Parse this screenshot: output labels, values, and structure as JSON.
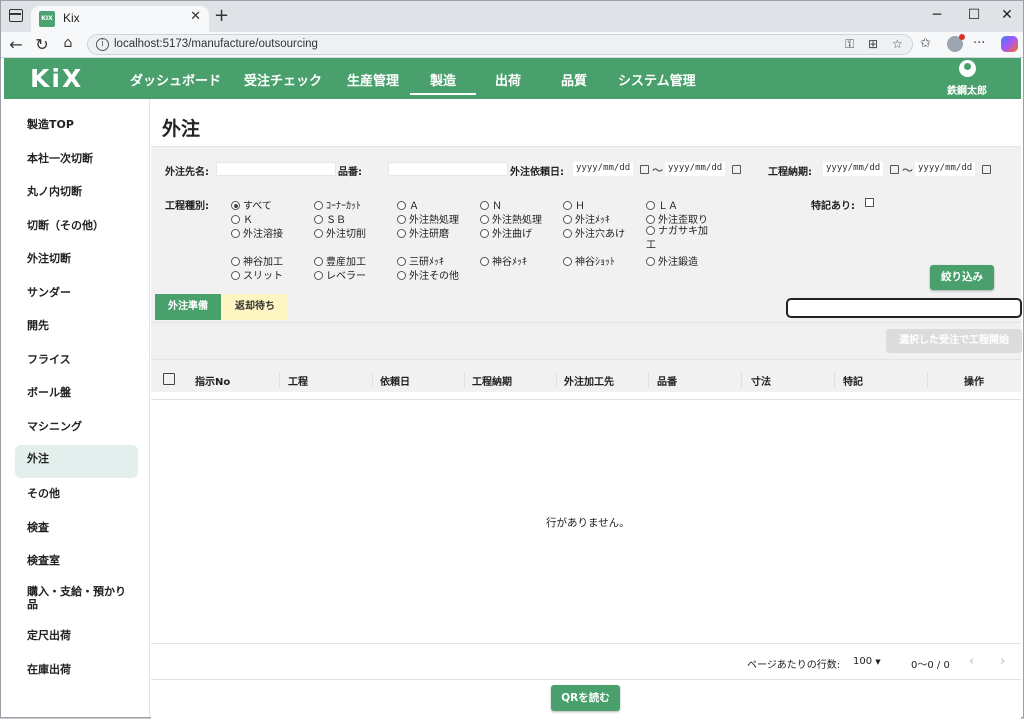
{
  "browser": {
    "tab_title": "Kix",
    "favicon_text": "KIX",
    "url": "localhost:5173/manufacture/outsourcing"
  },
  "header": {
    "logo": "KiX",
    "nav": [
      "ダッシュボード",
      "受注チェック",
      "生産管理",
      "製造",
      "出荷",
      "品質",
      "システム管理"
    ],
    "active_nav": "製造",
    "user_name": "鉄鋼太郎"
  },
  "sidebar": {
    "items": [
      "製造TOP",
      "本社一次切断",
      "丸ノ内切断",
      "切断（その他）",
      "外注切断",
      "サンダー",
      "開先",
      "フライス",
      "ボール盤",
      "マシニング",
      "外注",
      "その他",
      "検査",
      "検査室",
      "購入・支給・預かり品",
      "定尺出荷",
      "在庫出荷"
    ],
    "active": "外注"
  },
  "page": {
    "title": "外注"
  },
  "filters": {
    "vendor_label": "外注先名:",
    "part_label": "品番:",
    "request_date_label": "外注依頼日:",
    "process_due_label": "工程納期:",
    "date_placeholder": "yyyy/mm/dd",
    "tilde": "〜",
    "process_type_label": "工程種別:",
    "special_label": "特記あり:",
    "process_types": [
      "すべて",
      "ｺｰﾅｰｶｯﾄ",
      "Ａ",
      "Ｎ",
      "Ｈ",
      "ＬＡ",
      "Ｋ",
      "ＳＢ",
      "外注熱処理",
      "外注熱処理",
      "外注ﾒｯｷ",
      "外注歪取り",
      "外注溶接",
      "外注切削",
      "外注研磨",
      "外注曲げ",
      "外注穴あけ",
      "ナガサキ加工",
      "神谷加工",
      "豊産加工",
      "三研ﾒｯｷ",
      "神谷ﾒｯｷ",
      "神谷ｼｮｯﾄ",
      "外注鍛造",
      "スリット",
      "レベラー",
      "外注その他"
    ],
    "selected_process_type": "すべて",
    "filter_button": "絞り込み"
  },
  "tabs": [
    {
      "label": "外注準備",
      "active": true
    },
    {
      "label": "返却待ち",
      "active": false
    }
  ],
  "actions": {
    "start_button": "選択した受注で工程開始"
  },
  "table": {
    "columns": [
      "指示No",
      "工程",
      "依頼日",
      "工程納期",
      "外注加工先",
      "品番",
      "寸法",
      "特記",
      "操作"
    ],
    "empty_text": "行がありません。",
    "rows_per_page_label": "ページあたりの行数:",
    "rows_per_page": "100",
    "range_text": "0〜0 / 0"
  },
  "footer": {
    "qr_button": "QRを読む"
  },
  "colors": {
    "brand": "#4aa06c",
    "active_sidebar": "#e3efec",
    "tab_inactive": "#fdf6c3"
  }
}
